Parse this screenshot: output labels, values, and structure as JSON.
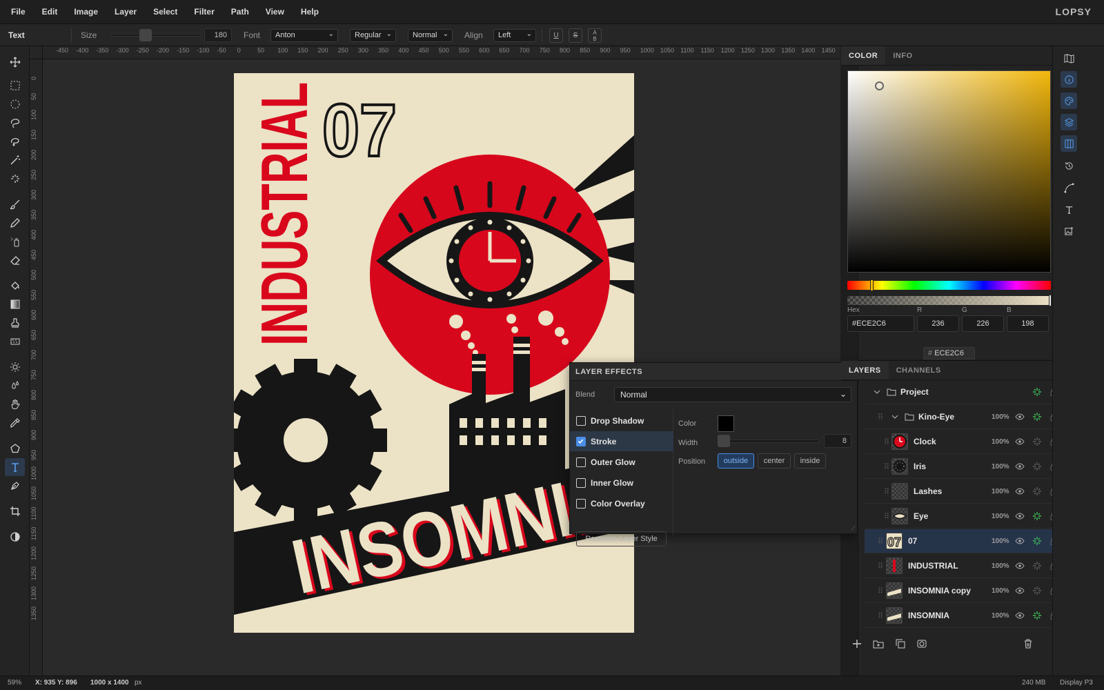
{
  "menu": [
    "File",
    "Edit",
    "Image",
    "Layer",
    "Select",
    "Filter",
    "Path",
    "View",
    "Help"
  ],
  "brand": "LOPSY",
  "options": {
    "tool": "Text",
    "size_label": "Size",
    "size_value": "180",
    "font_label": "Font",
    "font_value": "Anton",
    "weight_value": "Regular",
    "mode_value": "Normal",
    "align_label": "Align",
    "align_value": "Left",
    "underline": "U",
    "strike": "S",
    "case": "A\nB"
  },
  "ruler": {
    "top": [
      "-450",
      "-400",
      "-350",
      "-300",
      "-250",
      "-200",
      "-150",
      "-100",
      "-50",
      "0",
      "50",
      "100",
      "150",
      "200",
      "250",
      "300",
      "350",
      "400",
      "450",
      "500",
      "550",
      "600",
      "650",
      "700",
      "750",
      "800",
      "850",
      "900",
      "950",
      "1000",
      "1050",
      "1100",
      "1150",
      "1200",
      "1250",
      "1300",
      "1350",
      "1400",
      "1450"
    ],
    "left": [
      "0",
      "50",
      "100",
      "150",
      "200",
      "250",
      "300",
      "350",
      "400",
      "450",
      "500",
      "550",
      "600",
      "650",
      "700",
      "750",
      "800",
      "850",
      "900",
      "950",
      "1000",
      "1050",
      "1100",
      "1150",
      "1200",
      "1250",
      "1300",
      "1350"
    ]
  },
  "color_panel": {
    "tabs": [
      "COLOR",
      "INFO"
    ],
    "hex_label": "Hex",
    "hex": "#ECE2C6",
    "r_label": "R",
    "r": "236",
    "g_label": "G",
    "g": "226",
    "b_label": "B",
    "b": "198",
    "swatch_hash": "#",
    "swatch_hex": "ECE2C6",
    "current_color": "#ece2c6"
  },
  "fx_panel": {
    "title": "LAYER EFFECTS",
    "blend_label": "Blend",
    "blend_value": "Normal",
    "effects": [
      {
        "label": "Drop Shadow",
        "checked": false
      },
      {
        "label": "Stroke",
        "checked": true
      },
      {
        "label": "Outer Glow",
        "checked": false
      },
      {
        "label": "Inner Glow",
        "checked": false
      },
      {
        "label": "Color Overlay",
        "checked": false
      }
    ],
    "rasterize": "Rasterize Layer Style",
    "color_label": "Color",
    "stroke_color": "#000000",
    "width_label": "Width",
    "width_value": "8",
    "position_label": "Position",
    "positions": [
      "outside",
      "center",
      "inside"
    ]
  },
  "layers_panel": {
    "tabs": [
      "LAYERS",
      "CHANNELS"
    ],
    "layers": [
      {
        "name": "Project",
        "opacity": ""
      },
      {
        "name": "Kino-Eye",
        "opacity": "100%"
      },
      {
        "name": "Clock",
        "opacity": "100%"
      },
      {
        "name": "Iris",
        "opacity": "100%"
      },
      {
        "name": "Lashes",
        "opacity": "100%"
      },
      {
        "name": "Eye",
        "opacity": "100%"
      },
      {
        "name": "07",
        "opacity": "100%"
      },
      {
        "name": "INDUSTRIAL",
        "opacity": "100%"
      },
      {
        "name": "INSOMNIA copy",
        "opacity": "100%"
      },
      {
        "name": "INSOMNIA",
        "opacity": "100%"
      }
    ]
  },
  "artwork": {
    "word_vertical": "INDUSTRIAL",
    "number": "07",
    "word_bottom": "INSOMNIA"
  },
  "status": {
    "zoom": "59%",
    "coords": "X: 935 Y: 896",
    "doc_size": "1000 x 1400",
    "unit": "px",
    "memory": "240 MB",
    "profile": "Display P3"
  },
  "colors": {
    "accent": "#4a8ee6",
    "poster_red": "#d9071c",
    "poster_black": "#161616",
    "poster_cream": "#ece2c6"
  }
}
